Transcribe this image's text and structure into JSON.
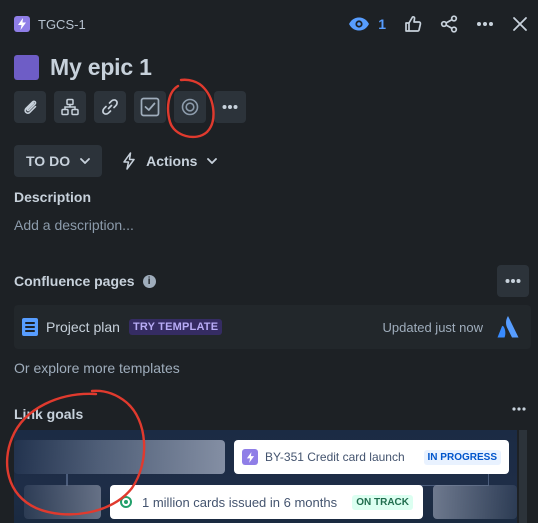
{
  "header": {
    "issue_key": "TGCS-1",
    "watchers_count": "1",
    "epic_icon": "lightning-icon"
  },
  "issue": {
    "title": "My epic 1"
  },
  "toolbar": {
    "buttons": [
      "attach-icon",
      "child-issues-icon",
      "link-icon",
      "checklist-icon",
      "goal-icon",
      "more-icon"
    ]
  },
  "status": {
    "current": "TO DO",
    "actions_label": "Actions"
  },
  "description": {
    "label": "Description",
    "placeholder": "Add a description..."
  },
  "confluence": {
    "label": "Confluence pages",
    "page_title": "Project plan",
    "lozenge": "TRY TEMPLATE",
    "updated": "Updated just now",
    "explore_link": "Or explore more templates"
  },
  "goals": {
    "label": "Link goals",
    "card1_text": "BY-351 Credit card launch",
    "card1_status": "IN PROGRESS",
    "card2_text": "1 million cards issued in 6 months",
    "card2_status": "ON TRACK"
  },
  "colors": {
    "background": "#1d2125",
    "accent_blue": "#579dff",
    "epic_purple": "#6e5dc6",
    "annotation_red": "#e03a2e"
  }
}
